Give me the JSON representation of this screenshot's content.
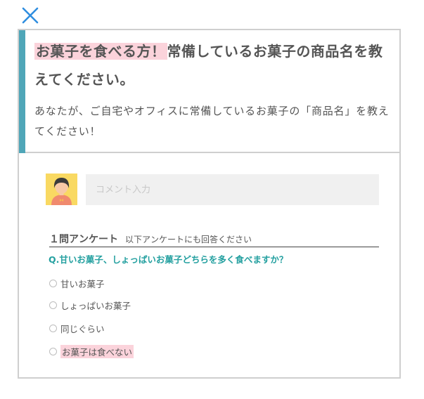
{
  "dialog": {
    "close_icon": "close-icon",
    "title_highlight": "お菓子を食べる方！",
    "title_rest": "常備しているお菓子の商品名を教えてください。",
    "description": "あなたが、ご自宅やオフィスに常備しているお菓子の「商品名」を教えてください！",
    "accent_color": "#4fa6b8",
    "highlight_color": "#fbd3db"
  },
  "comment": {
    "avatar_icon": "user-avatar-icon",
    "placeholder": "コメント入力"
  },
  "survey": {
    "title": "１問アンケート",
    "subtitle": "以下アンケートにも回答ください",
    "question": "Q.甘いお菓子、しょっぱいお菓子どちらを多く食べますか？",
    "question_color": "#24a0a0",
    "options": [
      "甘いお菓子",
      "しょっぱいお菓子",
      "同じぐらい",
      "お菓子は食べない"
    ]
  }
}
